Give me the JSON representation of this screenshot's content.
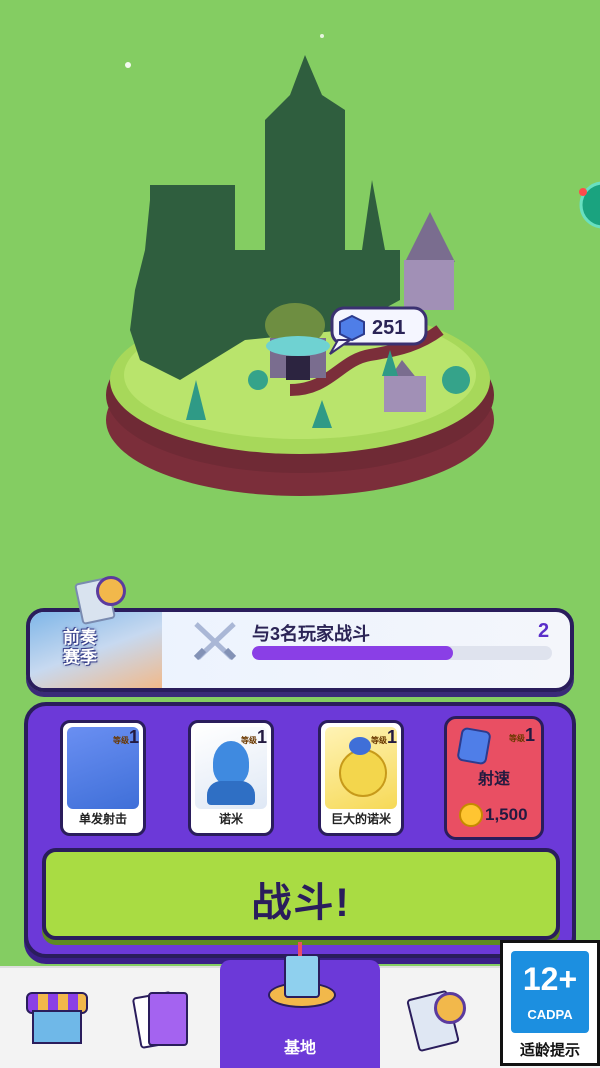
{
  "colors": {
    "grass": "#84cd62",
    "panel_purple": "#6c39d8",
    "button_green": "#a9dc43",
    "upgrade_red": "#e94f63",
    "progress_purple": "#8a3fe6"
  },
  "island": {
    "gem_count": "251",
    "gem_icon": "gem-icon"
  },
  "season": {
    "label_line1": "前奏",
    "label_line2": "赛季"
  },
  "quest": {
    "icon": "crossed-swords-icon",
    "text": "与3名玩家战斗",
    "count": "2",
    "progress_fraction": 0.67
  },
  "loadout": {
    "cards": [
      {
        "name": "单发射击",
        "level_label": "等级",
        "level": "1",
        "icon": "cannon-icon",
        "art_color": "#3f6fd8"
      },
      {
        "name": "诺米",
        "level_label": "等级",
        "level": "1",
        "icon": "blue-nomi-icon",
        "art_color": "#3f8ae0"
      },
      {
        "name": "巨大的诺米",
        "level_label": "等级",
        "level": "1",
        "icon": "yellow-nomi-icon",
        "art_color": "#f3d64c"
      }
    ],
    "upgrade": {
      "level_label": "等级",
      "level": "1",
      "name": "射速",
      "price": "1,500",
      "icon": "gem-cluster-icon",
      "coin_icon": "coin-icon"
    },
    "battle_label": "战斗!"
  },
  "nav": {
    "items": [
      {
        "icon": "shop-icon"
      },
      {
        "icon": "cards-icon"
      },
      {
        "icon": "base-icon",
        "label": "基地",
        "active": true
      },
      {
        "icon": "season-card-icon"
      }
    ]
  },
  "rating": {
    "age": "12+",
    "org": "CADPA",
    "caption": "适龄提示"
  }
}
